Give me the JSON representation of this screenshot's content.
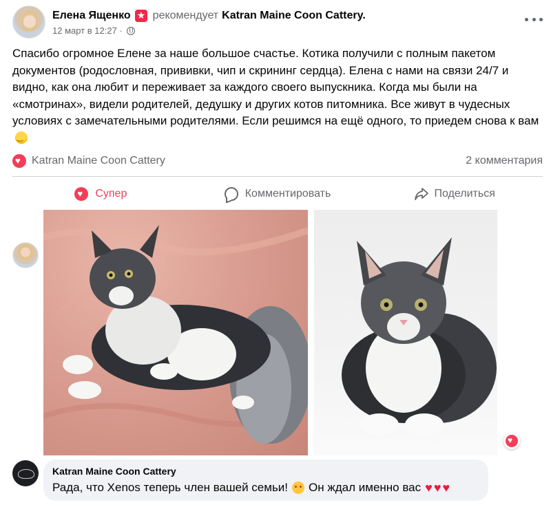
{
  "post": {
    "author": "Елена Ященко",
    "recommends_verb": "рекомендует",
    "target": "Katran Maine Coon Cattery.",
    "date": "12 март в 12:27 ·",
    "text": "Спасибо огромное Елене за наше большое счастье. Котика получили с полным пакетом документов (родословная, прививки, чип и скрининг сердца). Елена с нами на связи 24/7 и видно, как она любит и переживает за каждого своего выпускника. Когда мы были на «смотринах», видели родителей, дедушку и других котов питомника. Все живут в чудесных условиях с замечательными родителями. Если решимся на ещё одного, то приедем снова к вам",
    "icons": {
      "recommend_badge": "recommend-star-icon",
      "privacy": "globe-icon",
      "menu": "more-icon",
      "text_emoji": "winking-face-emoji"
    }
  },
  "summary": {
    "page_name": "Katran Maine Coon Cattery",
    "comments_count": "2 комментария",
    "icon": "heart-reaction-icon"
  },
  "actions": {
    "super_label": "Супер",
    "comment_label": "Комментировать",
    "share_label": "Поделиться"
  },
  "colors": {
    "reaction_red": "#f33e58",
    "secondary_text": "#65676b",
    "comment_bg": "#f0f2f5",
    "divider": "#ced0d4"
  },
  "comment": {
    "author": "Katran Maine Coon Cattery",
    "text_before": "Рада, что Xenos теперь член вашей семьи!",
    "text_after": "Он ждал именно вас",
    "hearts": "♥♥♥",
    "emoji": "smiling-cat-with-heart-eyes-emoji"
  }
}
